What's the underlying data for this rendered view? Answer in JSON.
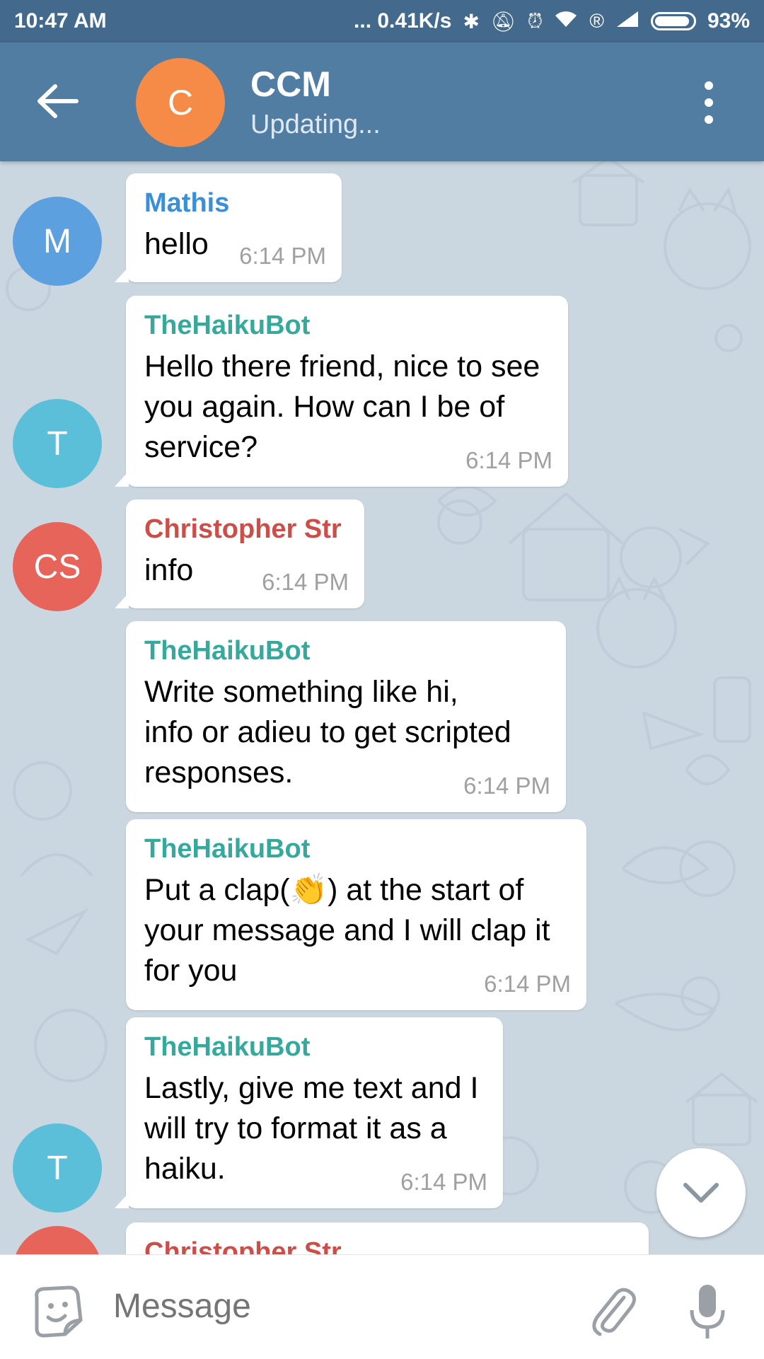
{
  "status_bar": {
    "time": "10:47 AM",
    "network_speed": "... 0.41K/s",
    "battery": "93%",
    "icons": [
      "bluetooth-icon",
      "mute-icon",
      "alarm-icon",
      "wifi-icon",
      "registered-icon",
      "signal-icon",
      "battery-icon"
    ]
  },
  "header": {
    "avatar_letter": "C",
    "avatar_color": "#f58b46",
    "title": "CCM",
    "status": "Updating..."
  },
  "messages": [
    {
      "avatar": "M",
      "avatar_color": "#5ca0e0",
      "sender": "Mathis",
      "sender_color": "#3a8fd6",
      "text": "hello",
      "time": "6:14 PM"
    },
    {
      "avatar": "T",
      "avatar_color": "#5bbfd9",
      "sender": "TheHaikuBot",
      "sender_color": "#36a89c",
      "text": "Hello there friend, nice to see you again. How can I be of service?",
      "time": "6:14 PM"
    },
    {
      "avatar": "CS",
      "avatar_color": "#e6645a",
      "sender": "Christopher Str",
      "sender_color": "#cc4e48",
      "text": "info",
      "time": "6:14 PM"
    },
    {
      "avatar": "",
      "avatar_color": "",
      "sender": "TheHaikuBot",
      "sender_color": "#36a89c",
      "text": "Write something like hi, info or adieu to get scripted responses.",
      "time": "6:14 PM"
    },
    {
      "avatar": "",
      "avatar_color": "",
      "sender": "TheHaikuBot",
      "sender_color": "#36a89c",
      "text_before": "Put a clap(",
      "emoji": "👏",
      "text_after": ") at the start of your message and I will clap it for you",
      "time": "6:14 PM"
    },
    {
      "avatar": "T",
      "avatar_color": "#5bbfd9",
      "sender": "TheHaikuBot",
      "sender_color": "#36a89c",
      "text": "Lastly, give me text and I will try to format it as a haiku.",
      "time": "6:14 PM"
    },
    {
      "avatar": "",
      "avatar_color": "#e6645a",
      "sender": "Christopher Str",
      "sender_color": "#cc4e48",
      "text": "",
      "time": ""
    }
  ],
  "input": {
    "placeholder": "Message"
  }
}
